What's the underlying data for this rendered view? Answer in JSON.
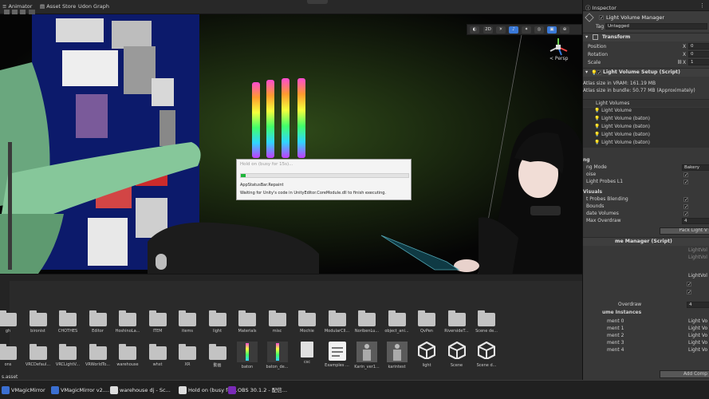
{
  "top_tabs": [
    "Animator",
    "Asset Store",
    "Udon Graph"
  ],
  "scene_toolbar": {
    "mode_2d": "2D",
    "persp_label": "< Persp"
  },
  "dialog": {
    "title": "Hold on (busy for 15s)...",
    "progress_fraction": 0.03,
    "task": "AppStatusBar.Repaint",
    "message": "Waiting for Unity's code in UnityEditor.CoreModule.dll to finish executing."
  },
  "inspector": {
    "tab_label": "Inspector",
    "object_name": "Light Volume Manager",
    "tag_label": "Tag",
    "tag_value": "Untagged",
    "transform": {
      "header": "Transform",
      "rows": [
        {
          "label": "Position",
          "axis": "X",
          "value": "0"
        },
        {
          "label": "Rotation",
          "axis": "X",
          "value": "0"
        },
        {
          "label": "Scale",
          "axis": "X",
          "value": "1"
        }
      ]
    },
    "setup": {
      "header": "Light Volume Setup (Script)",
      "atlas_vram": "Atlas size in VRAM: 161.19 MB",
      "atlas_bundle": "Atlas size in bundle: 50.77 MB (Approximately)",
      "volumes_header": "Light Volumes",
      "volumes": [
        "Light Volume",
        "Light Volume (baton)",
        "Light Volume (baton)",
        "Light Volume (baton)",
        "Light Volume (baton)"
      ],
      "baking_header": "ng",
      "baking_mode_label": "ng Mode",
      "baking_mode_value": "Bakery",
      "denoise_label": "oise",
      "fix_probes_label": "Light Probes L1",
      "visuals_header": "Visuals",
      "probes_blending_label": "t Probes Blending",
      "bounds_label": "Bounds",
      "update_volumes_label": "date Volumes",
      "max_overdraw_label": "Max Overdraw",
      "max_overdraw_value": "4",
      "pack_button": "Pack Light V"
    },
    "manager": {
      "header": "me Manager (Script)",
      "ref_1": "LightVol",
      "ref_2": "LightVol",
      "ref_3": "LightVol",
      "overdraw_label": "Overdraw",
      "overdraw_value": "4",
      "instances_header": "ume Instances",
      "elements": [
        "ment 0",
        "ment 1",
        "ment 2",
        "ment 3",
        "ment 4"
      ],
      "element_refs": [
        "Light Vo",
        "Light Vo",
        "Light Vo",
        "Light Vo",
        "Light Vo"
      ],
      "add_component": "Add Comp"
    }
  },
  "project": {
    "path_label": "s.asset",
    "row1": [
      "gh",
      "bironist",
      "CHOTHES",
      "Editor",
      "HoshinoLa...",
      "ITEM",
      "items",
      "light",
      "Materials",
      "misc",
      "Mochie",
      "ModularCll...",
      "NoribenLu...",
      "object_ani...",
      "QvPen",
      "RiversideT...",
      "Scene de..."
    ],
    "row2": [
      "ons",
      "VRCDefaul...",
      "VRCLightV...",
      "VRWorldTo...",
      "warehouse",
      "whst",
      "XR",
      "動画",
      "baton",
      "baton_de...",
      "csc",
      "Examples ...",
      "Karin_ver1...",
      "karintest",
      "light",
      "Scene",
      "Scene d..."
    ]
  },
  "taskbar": [
    {
      "label": "VMagicMirror",
      "color": "#3b6fd1"
    },
    {
      "label": "VMagicMirror v2....",
      "color": "#3b6fd1"
    },
    {
      "label": "warehouse dj - Sc...",
      "color": "#dddddd"
    },
    {
      "label": "Hold on (busy for...",
      "color": "#dddddd"
    },
    {
      "label": "OBS 30.1.2 - 配信...",
      "color": "#7a2ab8"
    }
  ],
  "colors": {
    "accent_blue": "#3a79d8",
    "progress_green": "#1eb53a",
    "inspector_bg": "#383838"
  }
}
